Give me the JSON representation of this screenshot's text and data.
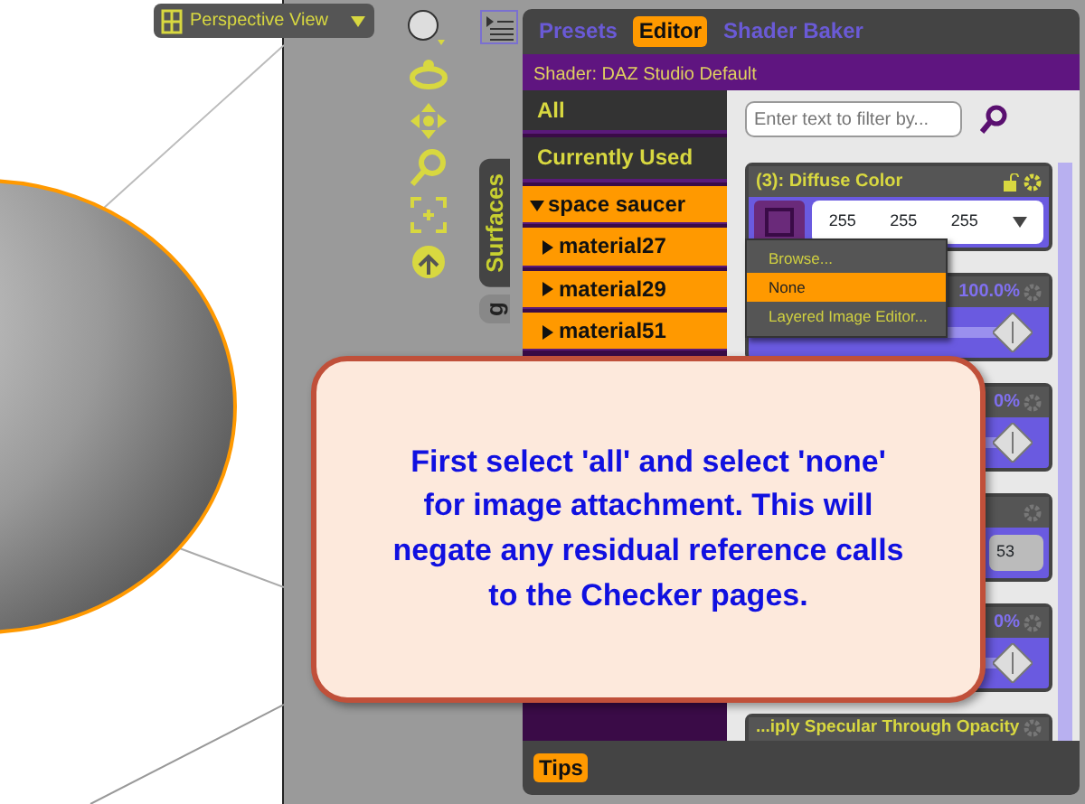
{
  "viewport": {
    "view_label": "Perspective View"
  },
  "panel": {
    "tabs": [
      {
        "label": "Presets",
        "selected": false
      },
      {
        "label": "Editor",
        "selected": true
      },
      {
        "label": "Shader Baker",
        "selected": false
      }
    ],
    "shader": "Shader: DAZ Studio Default",
    "side_tabs": [
      {
        "label": "Surfaces",
        "selected": true
      },
      {
        "label": "g",
        "selected": false
      }
    ],
    "surface_list": [
      {
        "label": "All",
        "kind": "filter",
        "selected": false
      },
      {
        "label": "Currently Used",
        "kind": "filter",
        "selected": false
      },
      {
        "label": "space saucer",
        "kind": "group",
        "selected": true,
        "expanded": true,
        "children": [
          {
            "label": "material27",
            "selected": true,
            "expanded": false
          },
          {
            "label": "material29",
            "selected": true,
            "expanded": false
          },
          {
            "label": "material51",
            "selected": true,
            "expanded": false
          }
        ]
      }
    ],
    "filter": {
      "placeholder": "Enter text to filter by..."
    },
    "properties": [
      {
        "kind": "color",
        "title": "(3): Diffuse Color",
        "values": [
          "255",
          "255",
          "255"
        ]
      },
      {
        "kind": "slider",
        "reading": "100.0%",
        "level": 0.92
      },
      {
        "kind": "slider",
        "reading": "0%",
        "level": 0.92
      },
      {
        "kind": "value",
        "value": "53"
      },
      {
        "kind": "slider",
        "reading": "0%",
        "level": 0.92
      },
      {
        "kind": "header",
        "title": "...iply Specular Through Opacity"
      }
    ],
    "menu": [
      {
        "label": "Browse...",
        "selected": false
      },
      {
        "label": "None",
        "selected": true
      },
      {
        "label": "Layered Image Editor...",
        "selected": false
      }
    ],
    "bottom_tab": {
      "label": "Tips",
      "selected": true
    }
  },
  "callout": {
    "text": "First select 'all' and select 'none' for image attachment. This will negate any residual reference calls to the Checker pages."
  }
}
